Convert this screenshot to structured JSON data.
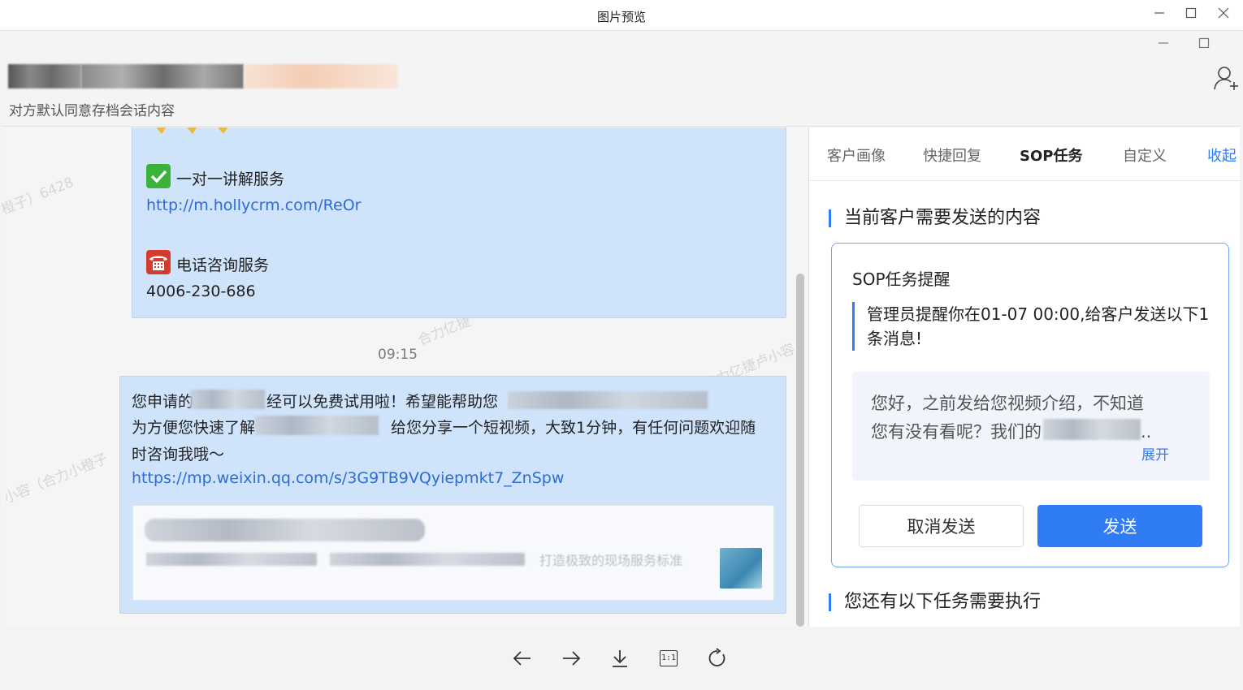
{
  "window": {
    "title": "图片预览",
    "controls": [
      "minimize-icon",
      "maximize-icon",
      "close-icon"
    ]
  },
  "chat": {
    "archive_note": "对方默认同意存档会话内容",
    "watermarks": [
      "橙子）6428",
      "合力亿捷",
      "合力亿捷卢小容",
      "小容（合力小橙子"
    ],
    "message1": {
      "service1_label": "一对一讲解服务",
      "service1_link": "http://m.hollycrm.com/ReOr",
      "service2_label": "电话咨询服务",
      "service2_phone": "4006-230-686"
    },
    "time": "09:15",
    "message2": {
      "line1_a": "您申请的",
      "line1_b": "经可以免费试用啦！希望能帮助您",
      "line2_a": "为方便您快速了解",
      "line2_b": "给您分享一个短视频，大致1分钟，有任何问题欢迎随",
      "line3": "时咨询我哦～",
      "link": "https://mp.weixin.qq.com/s/3G9TB9VQyiepmkt7_ZnSpw",
      "card_desc_tail": "打造极致的现场服务标准"
    }
  },
  "side_panel": {
    "tabs": [
      {
        "label": "客户画像",
        "active": false
      },
      {
        "label": "快捷回复",
        "active": false
      },
      {
        "label": "SOP任务",
        "active": true
      },
      {
        "label": "自定义",
        "active": false
      }
    ],
    "collapse_label": "收起",
    "section1_title": "当前客户需要发送的内容",
    "sop_card": {
      "title": "SOP任务提醒",
      "reminder": "管理员提醒你在01-07 00:00,给客户发送以下1条消息!",
      "message_line1": "您好，之前发给您视频介绍，不知道",
      "message_line2": "您有没有看呢？我们的",
      "message_ellipsis": "..",
      "expand_label": "展开",
      "cancel_label": "取消发送",
      "send_label": "发送"
    },
    "section2_title": "您还有以下任务需要执行"
  },
  "toolbar": {
    "tools": [
      "prev-icon",
      "next-icon",
      "download-icon",
      "actual-size-icon",
      "rotate-icon"
    ],
    "actual_size_label": "1:1"
  },
  "colors": {
    "accent": "#2f7cf5",
    "bubble": "#cfe3fb",
    "link": "#2f6bd6"
  }
}
